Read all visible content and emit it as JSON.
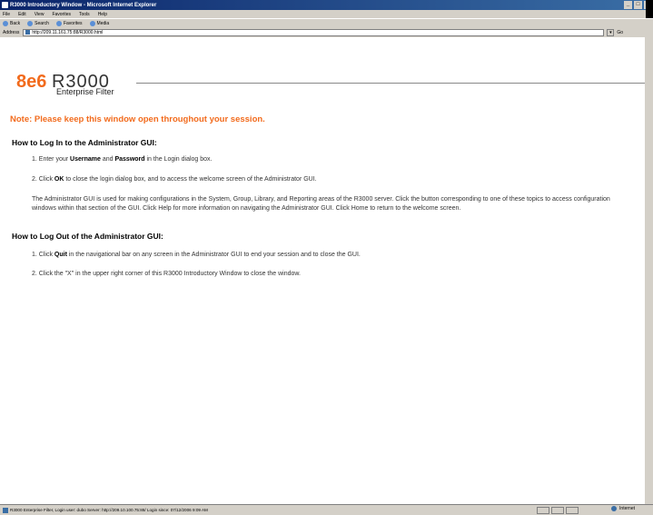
{
  "window": {
    "title": "R3000 Introductory Window - Microsoft Internet Explorer",
    "controls": [
      "_",
      "□",
      "x"
    ]
  },
  "menu": [
    "File",
    "Edit",
    "View",
    "Favorites",
    "Tools",
    "Help"
  ],
  "toolbar": {
    "back": "Back",
    "search": "Search",
    "favorites": "Favorites",
    "media": "Media"
  },
  "address": {
    "label": "Address",
    "url": "http://209.11.161.75:88/R3000.html",
    "go": "Go"
  },
  "logo": {
    "brand": "8e6",
    "product": "R3000",
    "subtitle": "Enterprise Filter"
  },
  "note": "Note: Please keep this window open throughout your session.",
  "login": {
    "heading": "How to Log In to the Administrator GUI:",
    "step1": {
      "pre": "1. Enter your ",
      "b1": "Username",
      "mid": " and ",
      "b2": "Password",
      "post": " in the Login dialog box."
    },
    "step2": {
      "pre": "2. Click ",
      "b": "OK",
      "post": " to close the login dialog box, and to access the welcome screen of the Administrator GUI."
    },
    "info": "The Administrator GUI is used for making configurations in the System, Group, Library, and Reporting areas of the R3000 server. Click the button corresponding to one of these topics to access configuration windows within that section of the GUI. Click Help for more information on navigating the Administrator GUI. Click Home to return to the welcome screen."
  },
  "logout": {
    "heading": "How to Log Out of the Administrator GUI:",
    "step1": {
      "pre": "1. Click ",
      "b": "Quit",
      "post": " in the navigational bar on any screen in the Administrator GUI to end your session and to close the GUI."
    },
    "step2": "2. Click the \"X\" in the upper right corner of this R3000 Introductory Window to close the window."
  },
  "status": {
    "text": "R3000 Enterprise Filter, Login user: dubo Server: http://209.10.100.75:88/ Login since: 07/12/2006 9:09 AM",
    "zone": "Internet"
  }
}
